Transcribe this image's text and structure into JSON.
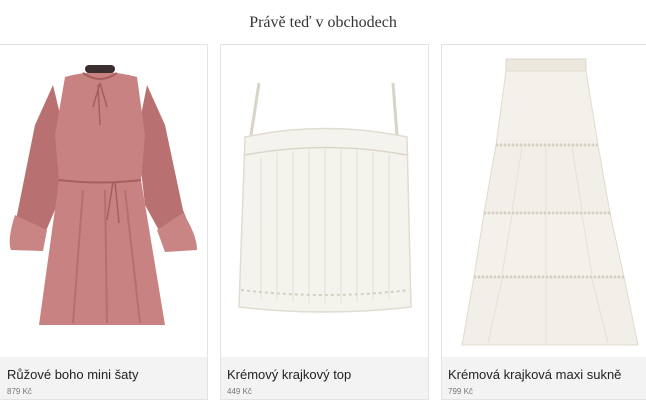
{
  "section": {
    "title": "Právě teď v obchodech"
  },
  "products": [
    {
      "name": "Růžové boho mini šaty",
      "price": "879 Kč",
      "image": "pink-boho-dress"
    },
    {
      "name": "Krémový krajkový top",
      "price": "449 Kč",
      "image": "cream-lace-top"
    },
    {
      "name": "Krémová krajková maxi sukně",
      "price": "799 Kč",
      "image": "cream-lace-maxi-skirt"
    }
  ],
  "colors": {
    "dress": "#c98282",
    "cream": "#f4f1ea",
    "info_bg": "#f3f3f3"
  }
}
